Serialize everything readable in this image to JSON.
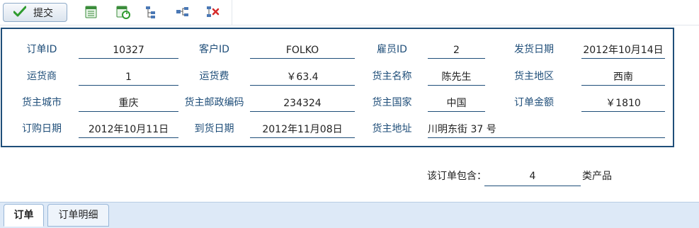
{
  "toolbar": {
    "submit_label": "提交",
    "icons": [
      "check-icon",
      "excel-export-icon",
      "excel-refresh-icon",
      "tree-expand-icon",
      "tree-add-node-icon",
      "tree-delete-node-icon"
    ]
  },
  "order": {
    "row1": [
      {
        "label": "订单ID",
        "value": "10327"
      },
      {
        "label": "客户ID",
        "value": "FOLKO"
      },
      {
        "label": "雇员ID",
        "value": "2"
      },
      {
        "label": "发货日期",
        "value": "2012年10月14日"
      }
    ],
    "row2": [
      {
        "label": "运货商",
        "value": "1"
      },
      {
        "label": "运货费",
        "value": "￥63.4"
      },
      {
        "label": "货主名称",
        "value": "陈先生"
      },
      {
        "label": "货主地区",
        "value": "西南"
      }
    ],
    "row3": [
      {
        "label": "货主城市",
        "value": "重庆"
      },
      {
        "label": "货主邮政编码",
        "value": "234324"
      },
      {
        "label": "货主国家",
        "value": "中国"
      },
      {
        "label": "订单金额",
        "value": "￥1810"
      }
    ],
    "row4": [
      {
        "label": "订购日期",
        "value": "2012年10月11日"
      },
      {
        "label": "到货日期",
        "value": "2012年11月08日"
      },
      {
        "label": "货主地址",
        "value": "川明东街 37 号"
      }
    ]
  },
  "summary": {
    "prefix": "该订单包含：",
    "count": "4",
    "suffix": "类产品"
  },
  "tabs": [
    {
      "label": "订单",
      "active": true
    },
    {
      "label": "订单明细",
      "active": false
    }
  ],
  "colors": {
    "accent": "#1f4e79",
    "tab_bar": "#dde9f7"
  }
}
